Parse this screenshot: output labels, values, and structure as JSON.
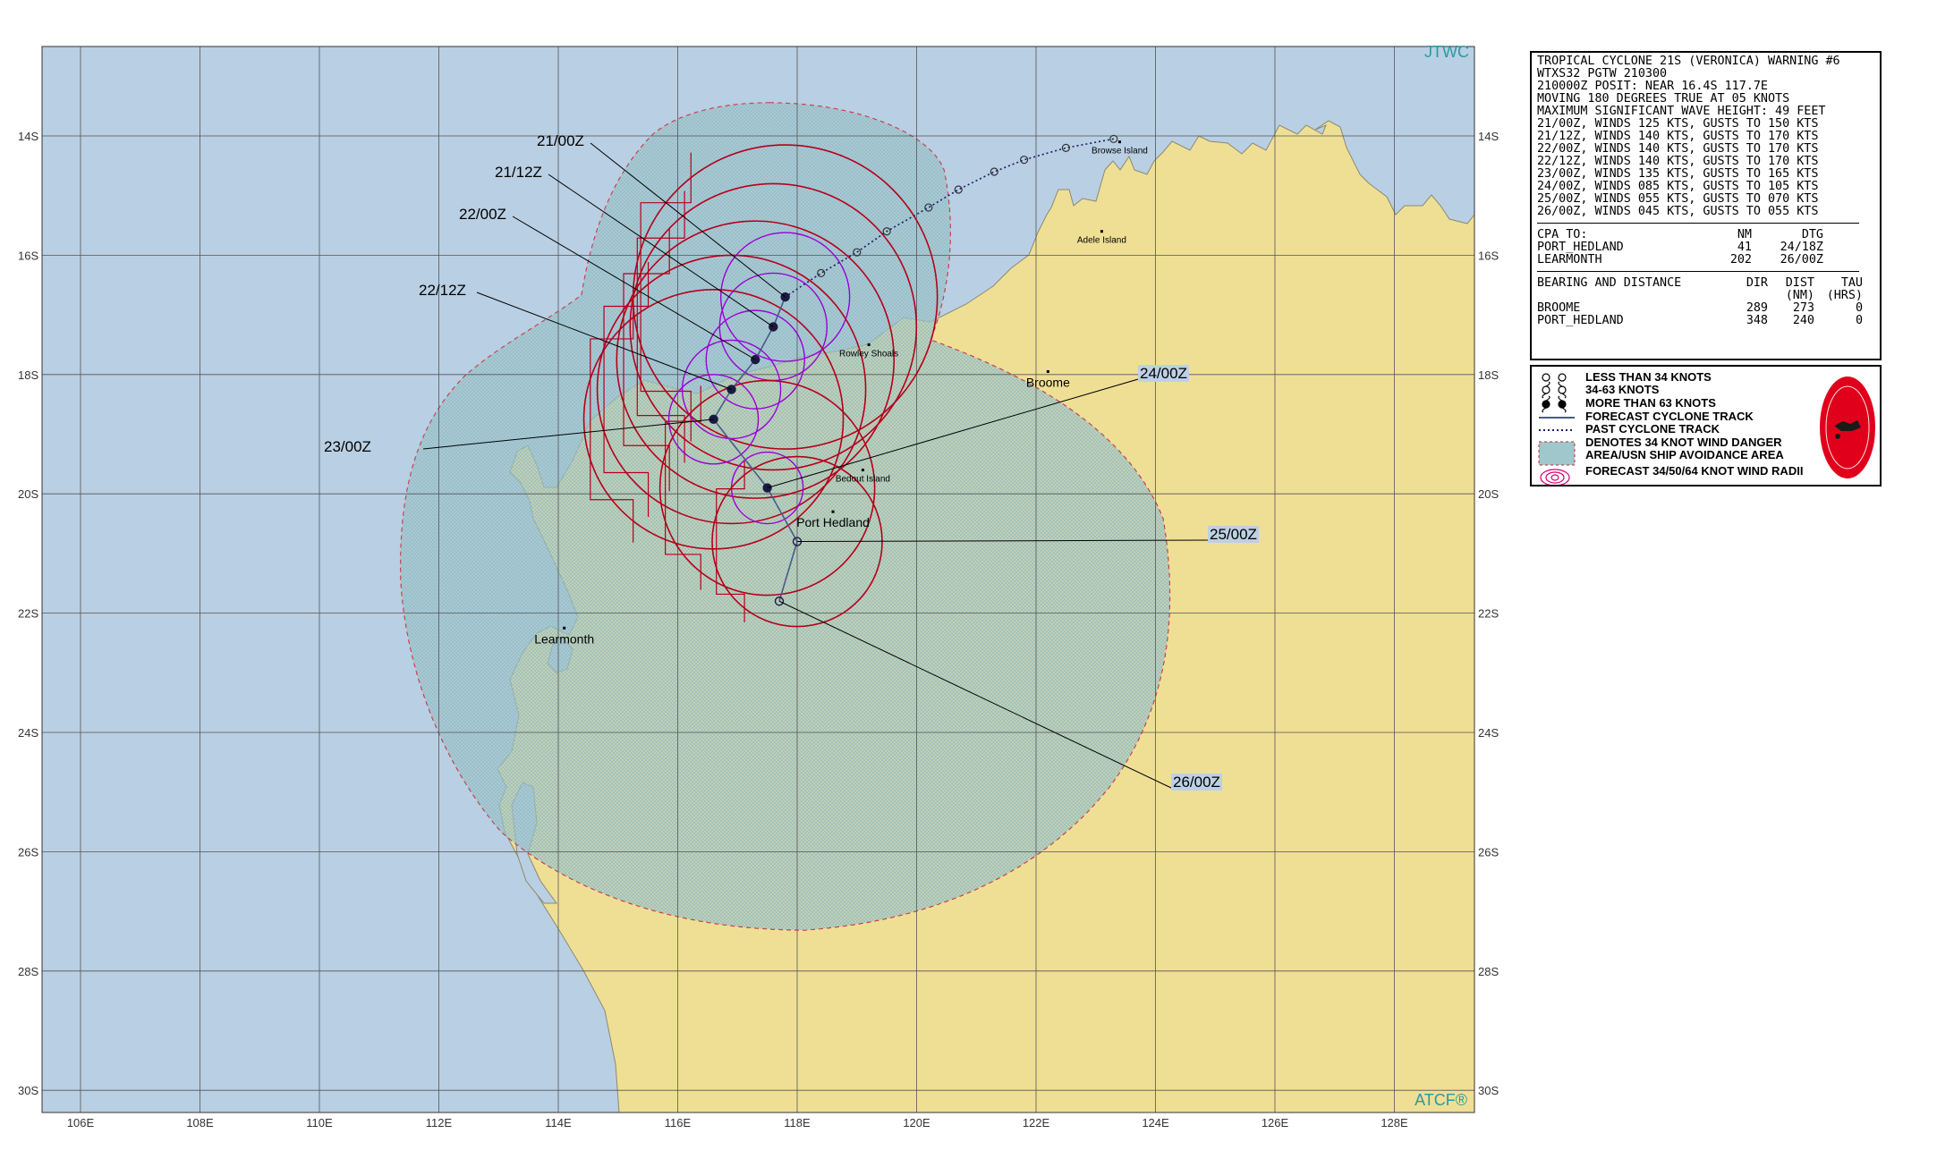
{
  "header": {
    "left": "JTWC",
    "right": "ATCF®"
  },
  "colors": {
    "ocean": "#b9cfe3",
    "land": "#efdf95",
    "danger_area": "#96c3cf",
    "wind_34": "#b5001b",
    "wind_50": "#9b00d6",
    "track": "#1a1a66",
    "grid": "#555555"
  },
  "lon_labels": [
    "106E",
    "108E",
    "110E",
    "112E",
    "114E",
    "116E",
    "118E",
    "120E",
    "122E",
    "124E",
    "126E",
    "128E"
  ],
  "lat_labels": [
    "14S",
    "16S",
    "18S",
    "20S",
    "22S",
    "24S",
    "26S",
    "28S",
    "30S"
  ],
  "places": [
    {
      "name": "Browse Island",
      "lon": 123.4,
      "lat": -14.1
    },
    {
      "name": "Adele Island",
      "lon": 123.1,
      "lat": -15.6
    },
    {
      "name": "Rowley Shoals",
      "lon": 119.2,
      "lat": -17.5
    },
    {
      "name": "Broome",
      "lon": 122.2,
      "lat": -17.95
    },
    {
      "name": "Bedout Island",
      "lon": 119.1,
      "lat": -19.6
    },
    {
      "name": "Port Hedland",
      "lon": 118.6,
      "lat": -20.3
    },
    {
      "name": "Learmonth",
      "lon": 114.1,
      "lat": -22.25
    }
  ],
  "forecast_track": [
    {
      "label": "21/00Z",
      "lon": 117.8,
      "lat": -16.7,
      "intensity": "more_than_63"
    },
    {
      "label": "21/12Z",
      "lon": 117.6,
      "lat": -17.2,
      "intensity": "more_than_63"
    },
    {
      "label": "22/00Z",
      "lon": 117.3,
      "lat": -17.75,
      "intensity": "more_than_63"
    },
    {
      "label": "22/12Z",
      "lon": 116.9,
      "lat": -18.25,
      "intensity": "more_than_63"
    },
    {
      "label": "23/00Z",
      "lon": 116.6,
      "lat": -18.75,
      "intensity": "more_than_63"
    },
    {
      "label": "24/00Z",
      "lon": 117.5,
      "lat": -19.9,
      "intensity": "more_than_63"
    },
    {
      "label": "25/00Z",
      "lon": 118.0,
      "lat": -20.8,
      "intensity": "34_to_63"
    },
    {
      "label": "26/00Z",
      "lon": 117.7,
      "lat": -21.8,
      "intensity": "less_than_34"
    }
  ],
  "past_track": [
    {
      "lon": 123.3,
      "lat": -14.05
    },
    {
      "lon": 122.5,
      "lat": -14.2
    },
    {
      "lon": 121.8,
      "lat": -14.4
    },
    {
      "lon": 121.3,
      "lat": -14.6
    },
    {
      "lon": 120.7,
      "lat": -14.9
    },
    {
      "lon": 120.2,
      "lat": -15.2
    },
    {
      "lon": 119.5,
      "lat": -15.6
    },
    {
      "lon": 119.0,
      "lat": -15.95
    },
    {
      "lon": 118.4,
      "lat": -16.3
    },
    {
      "lon": 117.8,
      "lat": -16.7
    }
  ],
  "info": {
    "lines": [
      "TROPICAL CYCLONE 21S (VERONICA) WARNING #6",
      "WTXS32 PGTW 210300",
      "210000Z POSIT: NEAR 16.4S 117.7E",
      "MOVING 180 DEGREES TRUE AT 05 KNOTS",
      "MAXIMUM SIGNIFICANT WAVE HEIGHT: 49 FEET",
      "21/00Z, WINDS 125 KTS, GUSTS TO 150 KTS",
      "21/12Z, WINDS 140 KTS, GUSTS TO 170 KTS",
      "22/00Z, WINDS 140 KTS, GUSTS TO 170 KTS",
      "22/12Z, WINDS 140 KTS, GUSTS TO 170 KTS",
      "23/00Z, WINDS 135 KTS, GUSTS TO 165 KTS",
      "24/00Z, WINDS 085 KTS, GUSTS TO 105 KTS",
      "25/00Z, WINDS 055 KTS, GUSTS TO 070 KTS",
      "26/00Z, WINDS 045 KTS, GUSTS TO 055 KTS"
    ],
    "cpa_header": [
      "CPA TO:",
      "NM",
      "DTG"
    ],
    "cpa": [
      [
        "PORT_HEDLAND",
        "41",
        "24/18Z"
      ],
      [
        "LEARMONTH",
        "202",
        "26/00Z"
      ]
    ],
    "bearing_header": [
      "BEARING AND DISTANCE",
      "DIR",
      "DIST",
      "TAU"
    ],
    "bearing_header2": [
      "",
      "",
      "(NM)",
      "(HRS)"
    ],
    "bearing": [
      [
        "BROOME",
        "289",
        "273",
        "0"
      ],
      [
        "PORT_HEDLAND",
        "348",
        "240",
        "0"
      ]
    ]
  },
  "legend": {
    "less34": "LESS THAN 34 KNOTS",
    "range34_63": "34-63 KNOTS",
    "more63": "MORE THAN 63 KNOTS",
    "forecast_track": "FORECAST CYCLONE TRACK",
    "past_track": "PAST CYCLONE TRACK",
    "danger1": "DENOTES 34 KNOT WIND DANGER",
    "danger2": "AREA/USN SHIP AVOIDANCE AREA",
    "radii": "FORECAST 34/50/64 KNOT WIND RADII"
  }
}
